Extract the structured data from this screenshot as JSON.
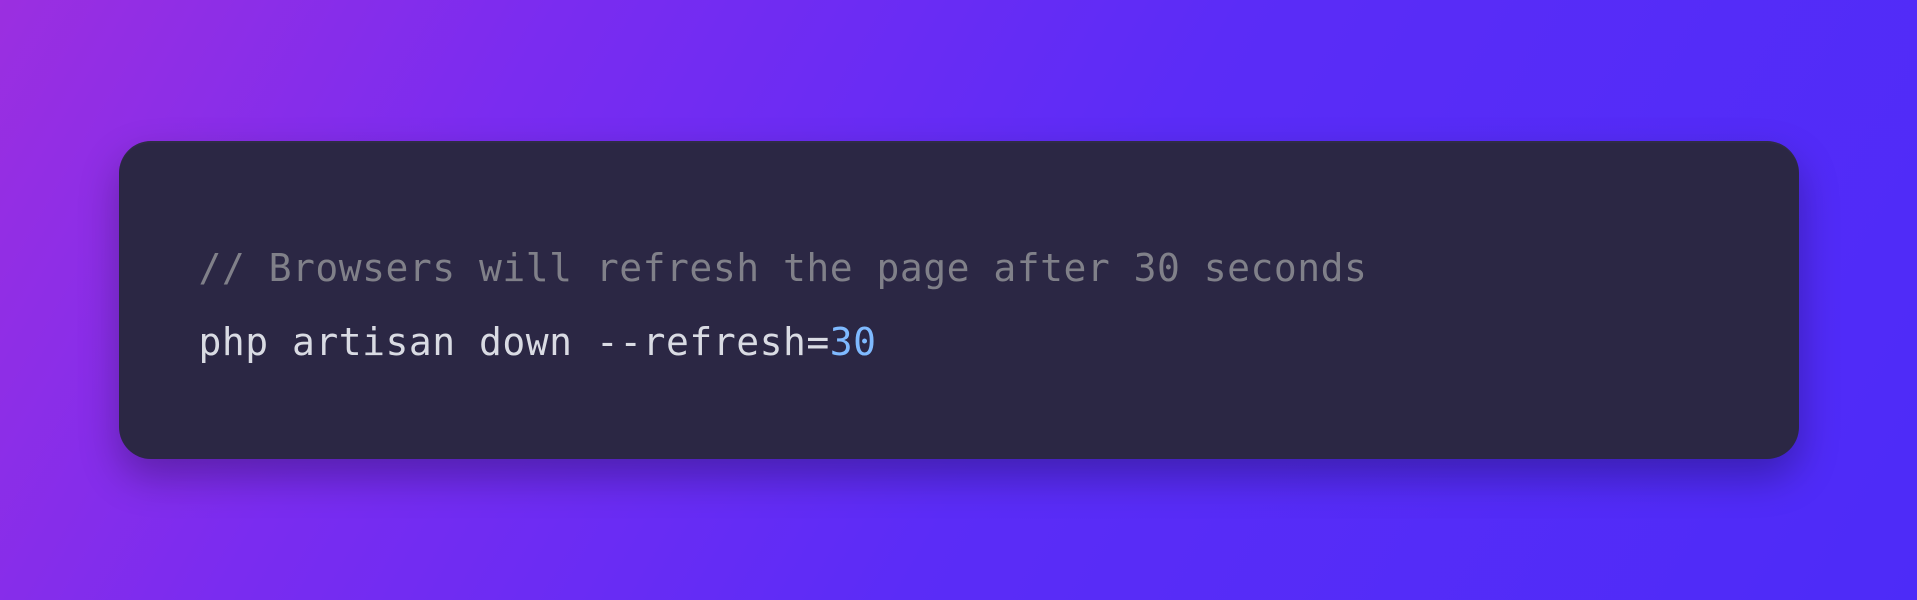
{
  "code": {
    "comment": "// Browsers will refresh the page after 30 seconds",
    "command_prefix": "php artisan down --refresh=",
    "command_number": "30"
  },
  "colors": {
    "card_bg": "#2b2744",
    "comment": "#808089",
    "plain": "#d9dbe3",
    "number": "#7fbaff",
    "gradient_start": "#9b2fe0",
    "gradient_end": "#4d2bf8"
  }
}
